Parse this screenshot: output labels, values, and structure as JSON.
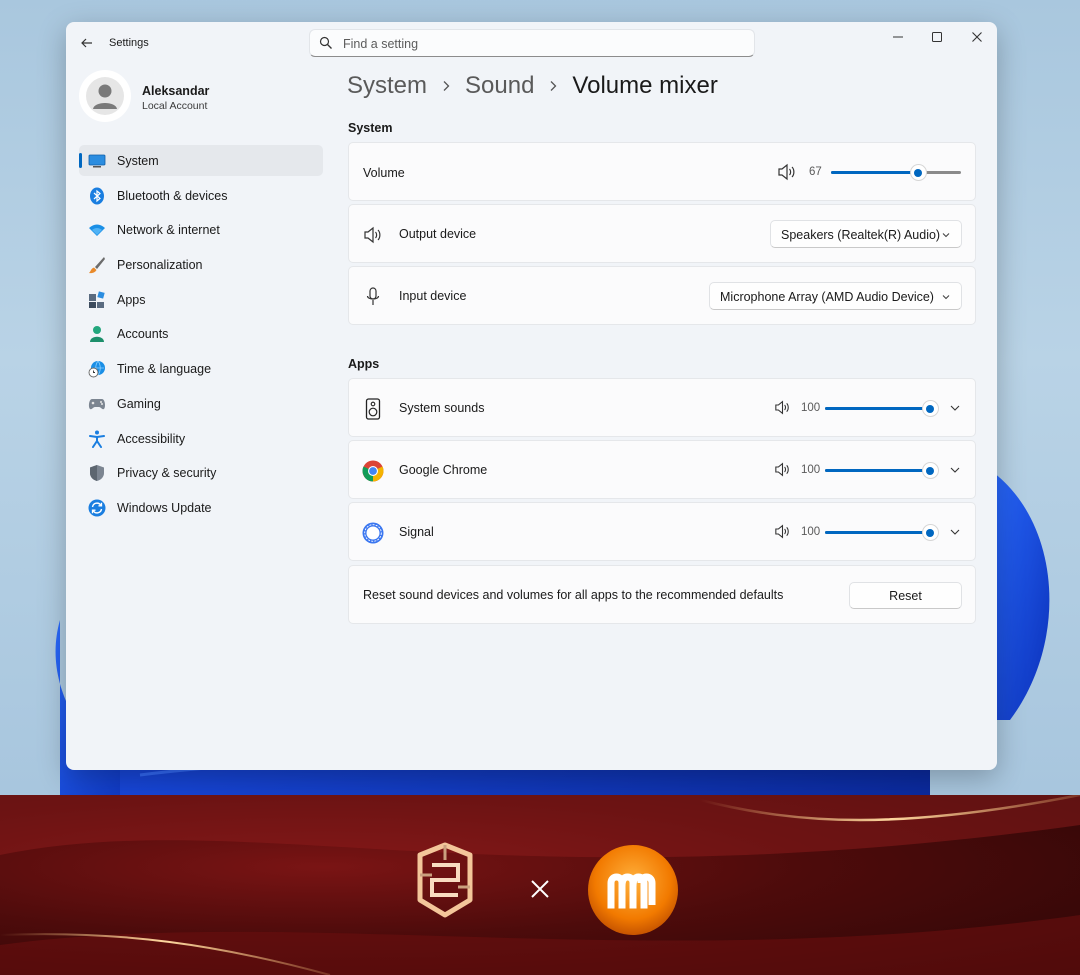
{
  "window": {
    "app_title": "Settings",
    "search_placeholder": "Find a setting"
  },
  "profile": {
    "name": "Aleksandar",
    "account_type": "Local Account"
  },
  "sidebar": {
    "items": [
      {
        "label": "System",
        "icon": "monitor-icon",
        "active": true
      },
      {
        "label": "Bluetooth & devices",
        "icon": "bluetooth-icon"
      },
      {
        "label": "Network & internet",
        "icon": "wifi-icon"
      },
      {
        "label": "Personalization",
        "icon": "brush-icon"
      },
      {
        "label": "Apps",
        "icon": "apps-icon"
      },
      {
        "label": "Accounts",
        "icon": "person-icon"
      },
      {
        "label": "Time & language",
        "icon": "globe-clock-icon"
      },
      {
        "label": "Gaming",
        "icon": "gamepad-icon"
      },
      {
        "label": "Accessibility",
        "icon": "accessibility-icon"
      },
      {
        "label": "Privacy & security",
        "icon": "shield-icon"
      },
      {
        "label": "Windows Update",
        "icon": "update-icon"
      }
    ]
  },
  "breadcrumb": {
    "items": [
      "System",
      "Sound",
      "Volume mixer"
    ]
  },
  "system_section": {
    "heading": "System",
    "volume": {
      "label": "Volume",
      "value": "67",
      "level": 67
    },
    "output_device": {
      "label": "Output device",
      "selected": "Speakers (Realtek(R) Audio)"
    },
    "input_device": {
      "label": "Input device",
      "selected": "Microphone Array (AMD Audio Device)"
    }
  },
  "apps_section": {
    "heading": "Apps",
    "apps": [
      {
        "name": "System sounds",
        "volume": "100",
        "level": 100,
        "icon": "speaker-box-icon"
      },
      {
        "name": "Google Chrome",
        "volume": "100",
        "level": 100,
        "icon": "chrome-icon"
      },
      {
        "name": "Signal",
        "volume": "100",
        "level": 100,
        "icon": "signal-icon"
      }
    ],
    "reset": {
      "text": "Reset sound devices and volumes for all apps to the recommended defaults",
      "button": "Reset"
    }
  },
  "colors": {
    "accent": "#0067c0",
    "window_bg": "#f1f4f8",
    "banner_bg": "#4d0b0b"
  }
}
